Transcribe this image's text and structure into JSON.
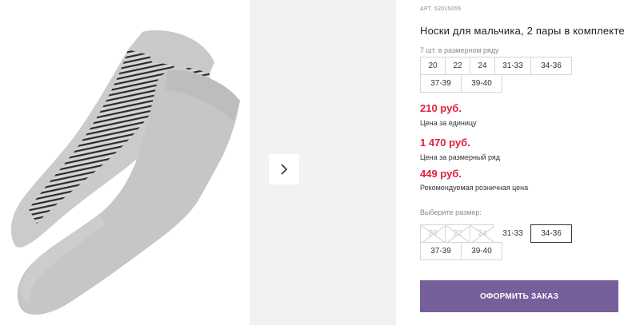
{
  "product": {
    "article": "АРТ. 52015055",
    "title": "Носки для мальчика, 2 пары в комплекте",
    "image_icon": "socks-photo"
  },
  "gallery": {
    "next_icon": "chevron-right-icon"
  },
  "size_row": {
    "note": "7 шт. в размерном ряду",
    "sizes": [
      "20",
      "22",
      "24",
      "31-33",
      "34-36",
      "37-39",
      "39-40"
    ]
  },
  "prices": [
    {
      "value": "210 руб.",
      "label": "Цена за единицу"
    },
    {
      "value": "1 470 руб.",
      "label": "Цена за размерный ряд"
    },
    {
      "value": "449 руб.",
      "label": "Рекомендуемая розничная цена"
    }
  ],
  "size_picker": {
    "label": "Выберите размер:",
    "options": [
      {
        "label": "20",
        "available": false
      },
      {
        "label": "22",
        "available": false
      },
      {
        "label": "24",
        "available": false
      },
      {
        "label": "31-33",
        "available": true
      },
      {
        "label": "34-36",
        "available": true,
        "selected": true
      },
      {
        "label": "37-39",
        "available": true
      },
      {
        "label": "39-40",
        "available": true
      }
    ]
  },
  "order_button": {
    "label": "ОФОРМИТЬ ЗАКАЗ"
  },
  "colors": {
    "price": "#e0203a",
    "button": "#775f9b",
    "gallery_bg": "#f2f2f2"
  }
}
